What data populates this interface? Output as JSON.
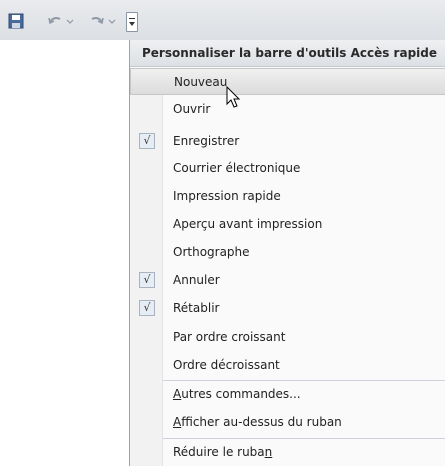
{
  "toolbar": {
    "icons": [
      "save-icon",
      "undo-icon",
      "redo-icon",
      "customize-dropdown-icon"
    ]
  },
  "menu": {
    "title": "Personnaliser la barre d'outils Accès rapide",
    "items": [
      {
        "label": "Nouveau",
        "checked": false,
        "hover": true
      },
      {
        "label": "Ouvrir",
        "checked": false
      },
      {
        "label": "Enregistrer",
        "checked": true
      },
      {
        "label": "Courrier électronique",
        "checked": false
      },
      {
        "label": "Impression rapide",
        "checked": false
      },
      {
        "label": "Aperçu avant impression",
        "checked": false
      },
      {
        "label": "Orthographe",
        "checked": false
      },
      {
        "label": "Annuler",
        "checked": true
      },
      {
        "label": "Rétablir",
        "checked": true
      },
      {
        "label": "Par ordre croissant",
        "checked": false
      },
      {
        "label": "Ordre décroissant",
        "checked": false
      }
    ],
    "more_commands": {
      "mnemonic": "A",
      "rest": "utres commandes..."
    },
    "show_below": {
      "mnemonic": "A",
      "rest": "fficher au-dessus du ruban"
    },
    "minimize": {
      "before": "Réduire le ruba",
      "mnemonic": "n"
    },
    "check_glyph": "√"
  }
}
